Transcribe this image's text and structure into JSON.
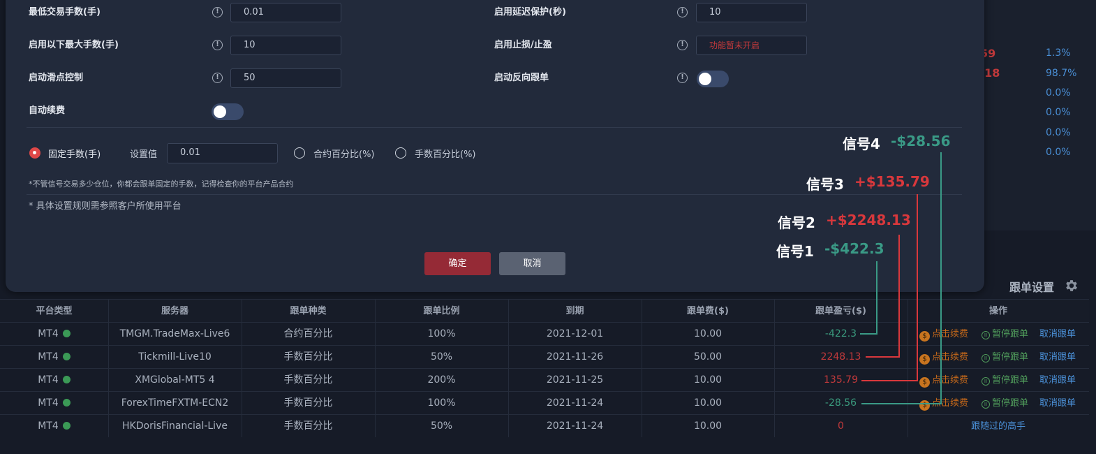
{
  "background": {
    "red_values": [
      "59",
      ".18"
    ],
    "percentages": [
      "1.3%",
      "98.7%",
      "0.0%",
      "0.0%",
      "0.0%",
      "0.0%"
    ]
  },
  "modal": {
    "left_rows": [
      {
        "label": "最低交易手数(手)",
        "value": "0.01"
      },
      {
        "label": "启用以下最大手数(手)",
        "value": "10"
      },
      {
        "label": "启动滑点控制",
        "value": "50"
      },
      {
        "label": "自动续费"
      }
    ],
    "right_rows": [
      {
        "label": "启用延迟保护(秒)",
        "value": "10"
      },
      {
        "label": "启用止损/止盈",
        "value": "功能暂未开启"
      },
      {
        "label": "启动反向跟单"
      }
    ],
    "info_glyph": "!",
    "mode": {
      "fixed_label": "固定手数(手)",
      "set_value_label": "设置值",
      "set_value": "0.01",
      "contract_pct_label": "合约百分比(%)",
      "lots_pct_label": "手数百分比(%)"
    },
    "note_fixed": "*不管信号交易多少仓位，你都会跟单固定的手数，记得检查你的平台产品合约",
    "note_rules": "* 具体设置规则需参照客户所使用平台",
    "confirm_label": "确定",
    "cancel_label": "取消"
  },
  "table": {
    "title": "跟单设置",
    "headers": [
      "平台类型",
      "服务器",
      "跟单种类",
      "跟单比例",
      "到期",
      "跟单费($)",
      "跟单盈亏($)",
      "操作"
    ],
    "rows": [
      {
        "platform": "MT4",
        "server": "TMGM.TradeMax-Live6",
        "type": "合约百分比",
        "ratio": "100%",
        "expiry": "2021-12-01",
        "fee": "10.00",
        "pnl": "-422.3",
        "pnl_color": "green"
      },
      {
        "platform": "MT4",
        "server": "Tickmill-Live10",
        "type": "手数百分比",
        "ratio": "50%",
        "expiry": "2021-11-26",
        "fee": "50.00",
        "pnl": "2248.13",
        "pnl_color": "red"
      },
      {
        "platform": "MT4",
        "server": "XMGlobal-MT5 4",
        "type": "手数百分比",
        "ratio": "200%",
        "expiry": "2021-11-25",
        "fee": "10.00",
        "pnl": "135.79",
        "pnl_color": "red"
      },
      {
        "platform": "MT4",
        "server": "ForexTimeFXTM-ECN2",
        "type": "手数百分比",
        "ratio": "100%",
        "expiry": "2021-11-24",
        "fee": "10.00",
        "pnl": "-28.56",
        "pnl_color": "green"
      },
      {
        "platform": "MT4",
        "server": "HKDorisFinancial-Live",
        "type": "手数百分比",
        "ratio": "50%",
        "expiry": "2021-11-24",
        "fee": "10.00",
        "pnl": "0",
        "pnl_color": "red"
      }
    ],
    "ops": {
      "renew": "点击续费",
      "pause": "暂停跟单",
      "cancel": "取消跟单",
      "followed": "跟随过的高手"
    },
    "coin_glyph": "$",
    "pause_glyph": "II"
  },
  "annotations": [
    {
      "label": "信号1",
      "value": "-$422.3",
      "color": "green"
    },
    {
      "label": "信号2",
      "value": "+$2248.13",
      "color": "red"
    },
    {
      "label": "信号3",
      "value": "+$135.79",
      "color": "red"
    },
    {
      "label": "信号4",
      "value": "-$28.56",
      "color": "green"
    }
  ],
  "colors": {
    "accent_red": "#952a36",
    "profit_red": "#d9383c",
    "loss_green": "#3a9a86",
    "status_green": "#3b9a56"
  }
}
